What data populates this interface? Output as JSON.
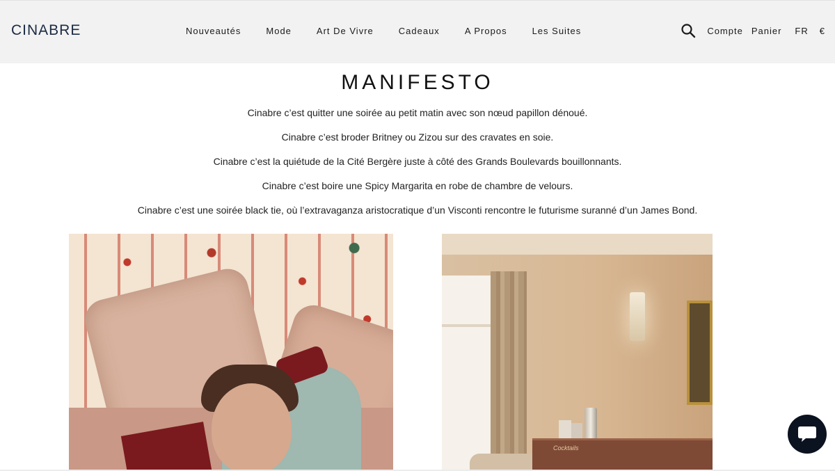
{
  "header": {
    "logo": "CINABRE",
    "nav": [
      "Nouveautés",
      "Mode",
      "Art De Vivre",
      "Cadeaux",
      "A Propos",
      "Les Suites"
    ],
    "search_icon": "search-icon",
    "account": "Compte",
    "cart": "Panier",
    "language": "FR",
    "currency": "€"
  },
  "main": {
    "title": "MANIFESTO",
    "lines": [
      "Cinabre c’est quitter une soirée au petit matin avec son nœud papillon dénoué.",
      "Cinabre c’est broder Britney ou Zizou sur des cravates en soie.",
      "Cinabre c’est la quiétude de la Cité Bergère juste à côté des Grands Boulevards bouillonnants.",
      "Cinabre c’est boire une Spicy Margarita en robe de chambre de velours.",
      "Cinabre c’est une soirée black tie, où l’extravaganza aristocratique d’un Visconti rencontre le futurisme suranné d’un James Bond."
    ]
  },
  "images": {
    "cart_sign": "Cocktails"
  },
  "chat": {
    "icon": "chat-bubble-icon"
  },
  "colors": {
    "logo": "#1b2a44",
    "header_bg": "#f2f2f2",
    "chat_bg": "#0b1220"
  }
}
